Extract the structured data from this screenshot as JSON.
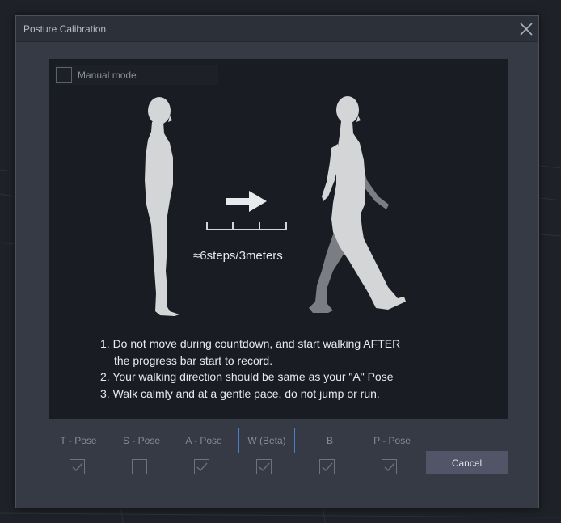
{
  "dialog": {
    "title": "Posture Calibration",
    "close_icon": "close-icon"
  },
  "manual_mode": {
    "label": "Manual mode",
    "checked": false
  },
  "illustration": {
    "distance_label": "≈6steps/3meters"
  },
  "instructions": {
    "line1": "1. Do not move during countdown, and start walking AFTER",
    "line1b": "the progress bar start to record.",
    "line2": "2. Your walking direction should be same as your \"A\" Pose",
    "line3": "3. Walk calmly and at a gentle pace, do not jump or run."
  },
  "poses": [
    {
      "label": "T - Pose",
      "checked": true
    },
    {
      "label": "S - Pose",
      "checked": false
    },
    {
      "label": "A - Pose",
      "checked": true
    },
    {
      "label": "W (Beta)",
      "checked": true,
      "selected": true
    },
    {
      "label": "B",
      "checked": true
    },
    {
      "label": "P - Pose",
      "checked": true
    }
  ],
  "buttons": {
    "cancel": "Cancel"
  },
  "colors": {
    "dialog_bg": "#353a45",
    "panel_bg": "#191c22",
    "selection_border": "#4d7fc4",
    "figure_light": "#d4d5d7",
    "figure_dark": "#7a7d82"
  }
}
